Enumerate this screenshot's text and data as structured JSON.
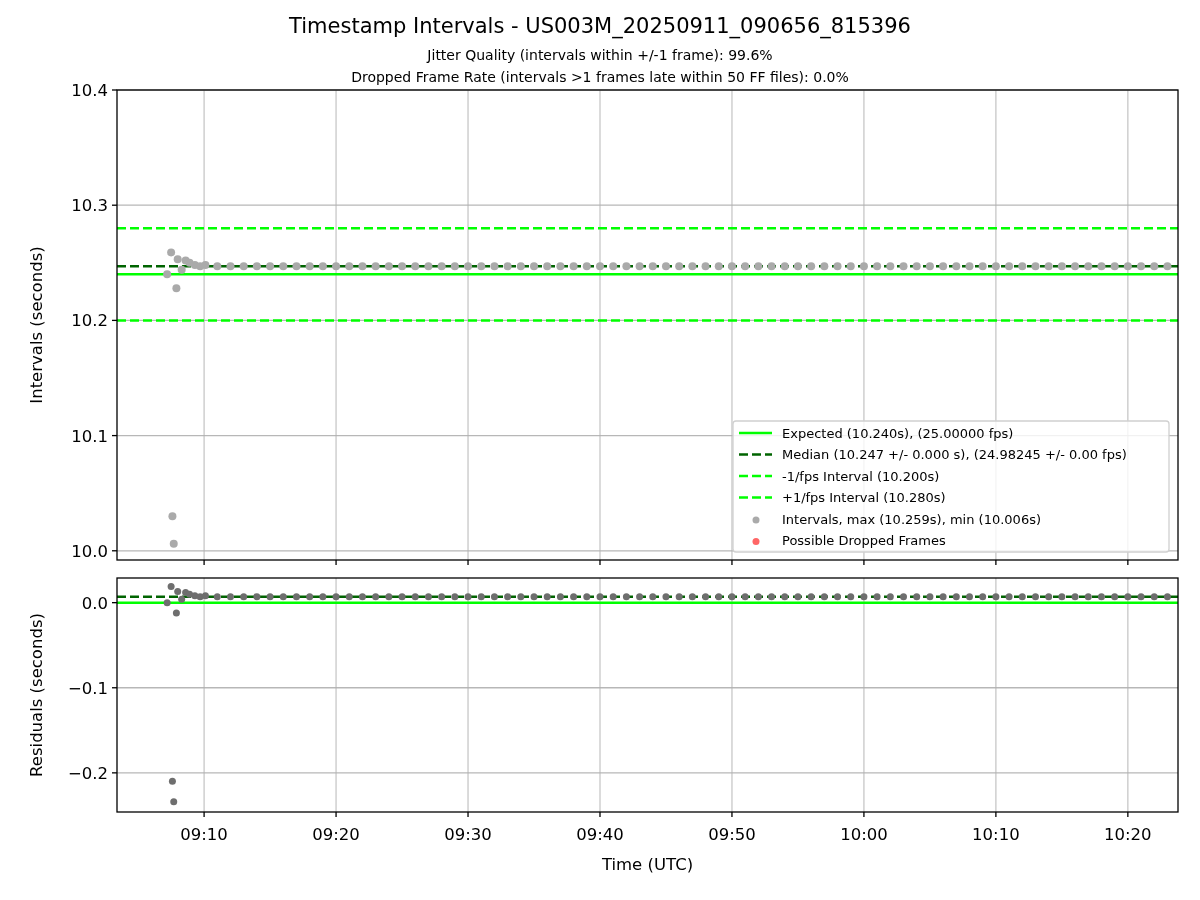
{
  "title": "Timestamp Intervals - US003M_20250911_090656_815396",
  "subtitle_lines": [
    "Jitter Quality (intervals within +/-1 frame): 99.6%",
    "Dropped Frame Rate (intervals >1 frames late within 50 FF files): 0.0%"
  ],
  "intervals_panel": {
    "chart_data": {
      "type": "scatter",
      "ylabel": "Intervals (seconds)",
      "xlim": [
        543.4,
        623.8
      ],
      "ylim": [
        9.992,
        10.4
      ],
      "grid": true,
      "legend": true,
      "yticks": [
        {
          "value": 10.0,
          "label": "10.0"
        },
        {
          "value": 10.1,
          "label": "10.1"
        },
        {
          "value": 10.2,
          "label": "10.2"
        },
        {
          "value": 10.3,
          "label": "10.3"
        },
        {
          "value": 10.4,
          "label": "10.4"
        }
      ],
      "ref_lines": [
        {
          "axis": "y",
          "value": 10.24,
          "label": "Expected (10.240s), (25.00000 fps)",
          "color": "#00ff00"
        },
        {
          "axis": "y",
          "value": 10.247,
          "label": "Median (10.247 +/- 0.000 s), (24.98245 +/- 0.00 fps)",
          "color": "#006400"
        },
        {
          "axis": "y",
          "value": 10.2,
          "label": "-1/fps Interval (10.200s)",
          "color": "#00ff00"
        },
        {
          "axis": "y",
          "value": 10.28,
          "label": "+1/fps Interval (10.280s)",
          "color": "#00ff00"
        }
      ],
      "series": [
        {
          "name": "Intervals, max (10.259s), min (10.006s)",
          "type": "scatter",
          "color": "#aaaaaa",
          "x": [
            547.2,
            547.5,
            547.6,
            547.7,
            547.9,
            548.0,
            548.3,
            548.6,
            548.9,
            549.3,
            549.7,
            550.1,
            551,
            552,
            553,
            554,
            555,
            556,
            557,
            558,
            559,
            560,
            561,
            562,
            563,
            564,
            565,
            566,
            567,
            568,
            569,
            570,
            571,
            572,
            573,
            574,
            575,
            576,
            577,
            578,
            579,
            580,
            581,
            582,
            583,
            584,
            585,
            586,
            587,
            588,
            589,
            590,
            591,
            592,
            593,
            594,
            595,
            596,
            597,
            598,
            599,
            600,
            601,
            602,
            603,
            604,
            605,
            606,
            607,
            608,
            609,
            610,
            611,
            612,
            613,
            614,
            615,
            616,
            617,
            618,
            619,
            620,
            621,
            622,
            623
          ],
          "values": [
            10.24,
            10.259,
            10.03,
            10.006,
            10.228,
            10.253,
            10.244,
            10.252,
            10.25,
            10.248,
            10.247,
            10.248,
            10.247,
            10.247,
            10.247,
            10.247,
            10.247,
            10.247,
            10.247,
            10.247,
            10.247,
            10.247,
            10.247,
            10.247,
            10.247,
            10.247,
            10.247,
            10.247,
            10.247,
            10.247,
            10.247,
            10.247,
            10.247,
            10.247,
            10.247,
            10.247,
            10.247,
            10.247,
            10.247,
            10.247,
            10.247,
            10.247,
            10.247,
            10.247,
            10.247,
            10.247,
            10.247,
            10.247,
            10.247,
            10.247,
            10.247,
            10.247,
            10.247,
            10.247,
            10.247,
            10.247,
            10.247,
            10.247,
            10.247,
            10.247,
            10.247,
            10.247,
            10.247,
            10.247,
            10.247,
            10.247,
            10.247,
            10.247,
            10.247,
            10.247,
            10.247,
            10.247,
            10.247,
            10.247,
            10.247,
            10.247,
            10.247,
            10.247,
            10.247,
            10.247,
            10.247,
            10.247,
            10.247,
            10.247,
            10.247
          ]
        },
        {
          "name": "Possible Dropped Frames",
          "type": "scatter",
          "color": "#ff6666"
        }
      ]
    }
  },
  "residuals_panel": {
    "chart_data": {
      "type": "scatter",
      "xlabel": "Time (UTC)",
      "ylabel": "Residuals (seconds)",
      "xlim": [
        543.4,
        623.8
      ],
      "ylim": [
        -0.246,
        0.029
      ],
      "grid": true,
      "xticks": [
        {
          "value": 550,
          "label": "09:10"
        },
        {
          "value": 560,
          "label": "09:20"
        },
        {
          "value": 570,
          "label": "09:30"
        },
        {
          "value": 580,
          "label": "09:40"
        },
        {
          "value": 590,
          "label": "09:50"
        },
        {
          "value": 600,
          "label": "10:00"
        },
        {
          "value": 610,
          "label": "10:10"
        },
        {
          "value": 620,
          "label": "10:20"
        }
      ],
      "yticks": [
        {
          "value": -0.2,
          "label": "−0.2"
        },
        {
          "value": -0.1,
          "label": "−0.1"
        },
        {
          "value": 0.0,
          "label": "0.0"
        }
      ],
      "ref_lines": [
        {
          "axis": "y",
          "value": 0,
          "color": "#00ff00"
        },
        {
          "axis": "y",
          "value": 0.007,
          "color": "#006400"
        }
      ],
      "series": [
        {
          "type": "scatter",
          "color": "#6e6e6e",
          "x": [
            547.2,
            547.5,
            547.6,
            547.7,
            547.9,
            548.0,
            548.3,
            548.6,
            548.9,
            549.3,
            549.7,
            550.1,
            551,
            552,
            553,
            554,
            555,
            556,
            557,
            558,
            559,
            560,
            561,
            562,
            563,
            564,
            565,
            566,
            567,
            568,
            569,
            570,
            571,
            572,
            573,
            574,
            575,
            576,
            577,
            578,
            579,
            580,
            581,
            582,
            583,
            584,
            585,
            586,
            587,
            588,
            589,
            590,
            591,
            592,
            593,
            594,
            595,
            596,
            597,
            598,
            599,
            600,
            601,
            602,
            603,
            604,
            605,
            606,
            607,
            608,
            609,
            610,
            611,
            612,
            613,
            614,
            615,
            616,
            617,
            618,
            619,
            620,
            621,
            622,
            623
          ],
          "values": [
            0.0,
            0.019,
            -0.21,
            -0.234,
            -0.012,
            0.013,
            0.004,
            0.012,
            0.01,
            0.008,
            0.007,
            0.008,
            0.007,
            0.007,
            0.007,
            0.007,
            0.007,
            0.007,
            0.007,
            0.007,
            0.007,
            0.007,
            0.007,
            0.007,
            0.007,
            0.007,
            0.007,
            0.007,
            0.007,
            0.007,
            0.007,
            0.007,
            0.007,
            0.007,
            0.007,
            0.007,
            0.007,
            0.007,
            0.007,
            0.007,
            0.007,
            0.007,
            0.007,
            0.007,
            0.007,
            0.007,
            0.007,
            0.007,
            0.007,
            0.007,
            0.007,
            0.007,
            0.007,
            0.007,
            0.007,
            0.007,
            0.007,
            0.007,
            0.007,
            0.007,
            0.007,
            0.007,
            0.007,
            0.007,
            0.007,
            0.007,
            0.007,
            0.007,
            0.007,
            0.007,
            0.007,
            0.007,
            0.007,
            0.007,
            0.007,
            0.007,
            0.007,
            0.007,
            0.007,
            0.007,
            0.007,
            0.007,
            0.007,
            0.007,
            0.007
          ]
        }
      ]
    }
  }
}
